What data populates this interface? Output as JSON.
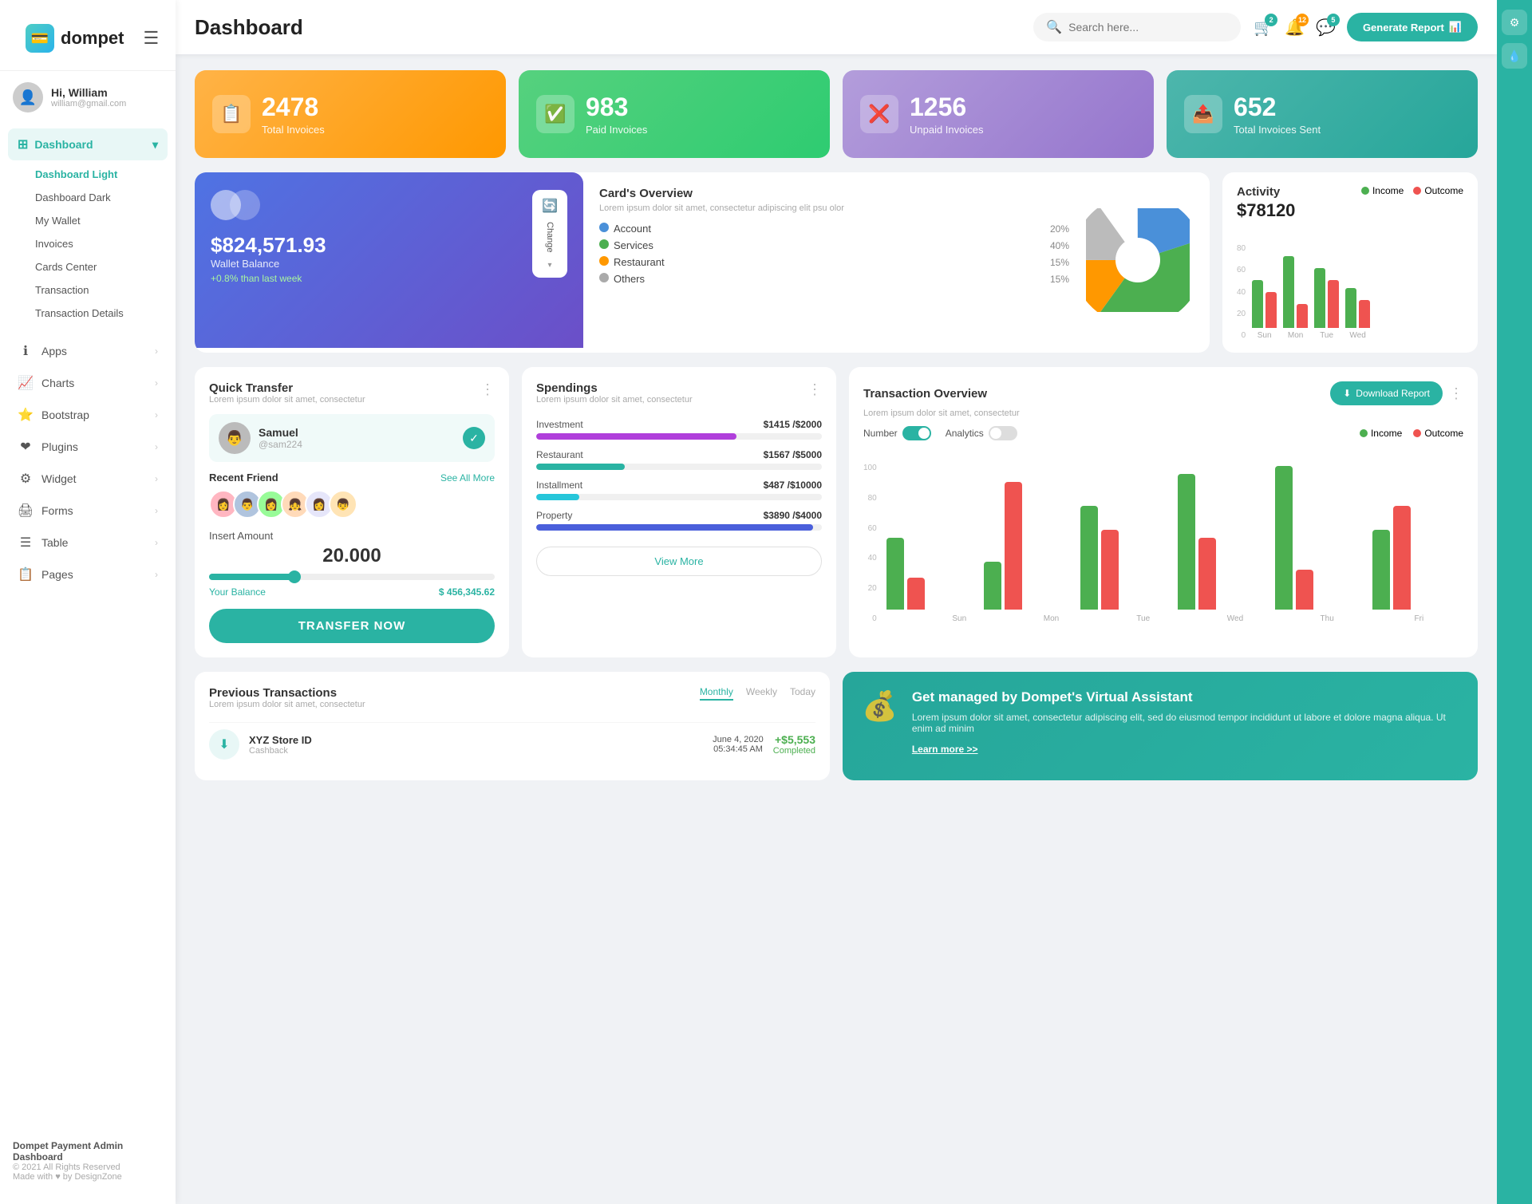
{
  "app": {
    "name": "dompet",
    "title": "Dashboard"
  },
  "header": {
    "search_placeholder": "Search here...",
    "generate_btn": "Generate Report",
    "badges": {
      "cart": "2",
      "bell": "12",
      "chat": "5"
    }
  },
  "user": {
    "greeting": "Hi, William",
    "email": "william@gmail.com"
  },
  "sidebar": {
    "dashboard_label": "Dashboard",
    "sub_items": [
      {
        "label": "Dashboard Light",
        "active": true
      },
      {
        "label": "Dashboard Dark",
        "active": false
      },
      {
        "label": "My Wallet",
        "active": false
      },
      {
        "label": "Invoices",
        "active": false
      },
      {
        "label": "Cards Center",
        "active": false
      },
      {
        "label": "Transaction",
        "active": false
      },
      {
        "label": "Transaction Details",
        "active": false
      }
    ],
    "nav_items": [
      {
        "label": "Apps",
        "icon": "ℹ"
      },
      {
        "label": "Charts",
        "icon": "📈"
      },
      {
        "label": "Bootstrap",
        "icon": "⭐"
      },
      {
        "label": "Plugins",
        "icon": "❤"
      },
      {
        "label": "Widget",
        "icon": "⚙"
      },
      {
        "label": "Forms",
        "icon": "🖨"
      },
      {
        "label": "Table",
        "icon": "☰"
      },
      {
        "label": "Pages",
        "icon": "📋"
      }
    ],
    "footer": {
      "company": "Dompet Payment Admin Dashboard",
      "copyright": "© 2021 All Rights Reserved",
      "made_with": "Made with ♥ by DesignZone"
    }
  },
  "stats": [
    {
      "num": "2478",
      "label": "Total Invoices",
      "icon": "📋",
      "color": "orange"
    },
    {
      "num": "983",
      "label": "Paid Invoices",
      "icon": "✅",
      "color": "green"
    },
    {
      "num": "1256",
      "label": "Unpaid Invoices",
      "icon": "❌",
      "color": "purple"
    },
    {
      "num": "652",
      "label": "Total Invoices Sent",
      "icon": "📋",
      "color": "teal"
    }
  ],
  "card_overview": {
    "title": "Card's Overview",
    "desc": "Lorem ipsum dolor sit amet, consectetur adipiscing elit psu olor",
    "wallet_amount": "$824,571.93",
    "wallet_label": "Wallet Balance",
    "wallet_change": "+0.8% than last week",
    "change_btn": "Change",
    "items": [
      {
        "name": "Account",
        "pct": "20%",
        "color": "#4a90d9"
      },
      {
        "name": "Services",
        "pct": "40%",
        "color": "#4caf50"
      },
      {
        "name": "Restaurant",
        "pct": "15%",
        "color": "#ff9800"
      },
      {
        "name": "Others",
        "pct": "15%",
        "color": "#aaa"
      }
    ]
  },
  "activity": {
    "title": "Activity",
    "amount": "$78120",
    "legend": [
      {
        "label": "Income",
        "color": "#4caf50"
      },
      {
        "label": "Outcome",
        "color": "#ef5350"
      }
    ],
    "bars": [
      {
        "day": "Sun",
        "income": 40,
        "outcome": 30
      },
      {
        "day": "Mon",
        "income": 70,
        "outcome": 20
      },
      {
        "day": "Tue",
        "income": 55,
        "outcome": 45
      },
      {
        "day": "Wed",
        "income": 35,
        "outcome": 25
      }
    ],
    "y_labels": [
      "80",
      "60",
      "40",
      "20",
      "0"
    ]
  },
  "quick_transfer": {
    "title": "Quick Transfer",
    "desc": "Lorem ipsum dolor sit amet, consectetur",
    "person": {
      "name": "Samuel",
      "handle": "@sam224"
    },
    "recent_label": "Recent Friend",
    "see_all": "See All More",
    "insert_label": "Insert Amount",
    "amount": "20.000",
    "balance_label": "Your Balance",
    "balance_val": "$ 456,345.62",
    "transfer_btn": "TRANSFER NOW",
    "friends": [
      "👩",
      "👨",
      "👩",
      "👧",
      "👩",
      "👦"
    ]
  },
  "spendings": {
    "title": "Spendings",
    "desc": "Lorem ipsum dolor sit amet, consectetur",
    "items": [
      {
        "name": "Investment",
        "current": "$1415",
        "max": "$2000",
        "pct": 70,
        "color": "#b03fdb"
      },
      {
        "name": "Restaurant",
        "current": "$1567",
        "max": "$5000",
        "pct": 31,
        "color": "#2ab3a3"
      },
      {
        "name": "Installment",
        "current": "$487",
        "max": "$10000",
        "pct": 15,
        "color": "#26c6da"
      },
      {
        "name": "Property",
        "current": "$3890",
        "max": "$4000",
        "pct": 97,
        "color": "#4a5fdb"
      }
    ],
    "view_more": "View More"
  },
  "txn_overview": {
    "title": "Transaction Overview",
    "desc": "Lorem ipsum dolor sit amet, consectetur",
    "download_btn": "Download Report",
    "toggles": [
      {
        "label": "Number",
        "on": true
      },
      {
        "label": "Analytics",
        "on": false
      }
    ],
    "legend": [
      {
        "label": "Income",
        "color": "#4caf50"
      },
      {
        "label": "Outcome",
        "color": "#ef5350"
      }
    ],
    "bars": [
      {
        "day": "Sun",
        "income": 45,
        "outcome": 20
      },
      {
        "day": "Mon",
        "income": 30,
        "outcome": 80
      },
      {
        "day": "Tue",
        "income": 65,
        "outcome": 50
      },
      {
        "day": "Wed",
        "income": 85,
        "outcome": 45
      },
      {
        "day": "Thu",
        "income": 90,
        "outcome": 25
      },
      {
        "day": "Fri",
        "income": 50,
        "outcome": 65
      }
    ],
    "y_labels": [
      "100",
      "80",
      "60",
      "40",
      "20",
      "0"
    ]
  },
  "prev_transactions": {
    "title": "Previous Transactions",
    "desc": "Lorem ipsum dolor sit amet, consectetur",
    "tabs": [
      "Monthly",
      "Weekly",
      "Today"
    ],
    "active_tab": "Monthly",
    "rows": [
      {
        "icon": "⬇",
        "name": "XYZ Store ID",
        "sub": "Cashback",
        "date": "June 4, 2020",
        "time": "05:34:45 AM",
        "amount": "+$5,553",
        "status": "Completed"
      }
    ]
  },
  "va_banner": {
    "title": "Get managed by Dompet's Virtual Assistant",
    "desc": "Lorem ipsum dolor sit amet, consectetur adipiscing elit, sed do eiusmod tempor incididunt ut labore et dolore magna aliqua. Ut enim ad minim",
    "learn_more": "Learn more >>"
  }
}
